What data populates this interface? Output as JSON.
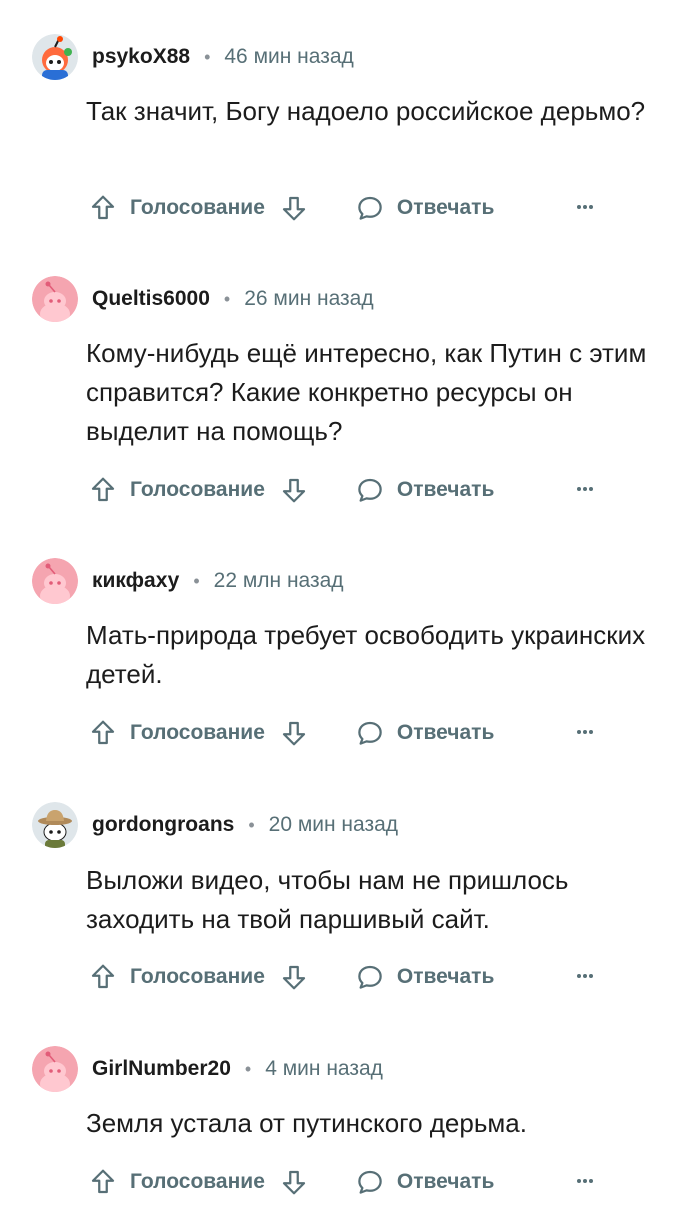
{
  "comments": [
    {
      "username": "psykoX88",
      "time": "46 мин назад",
      "text": "Так значит, Богу надоело российское дерьмо?",
      "vote_label": "Голосование",
      "reply_label": "Отвечать",
      "more": "···",
      "avatar": "snoo-redhead-avatar"
    },
    {
      "username": "Queltis6000",
      "time": "26 мин назад",
      "text": "Кому-нибудь ещё интересно, как Путин с этим справится? Какие конкретно ресурсы он выделит на помощь?",
      "vote_label": "Голосование",
      "reply_label": "Отвечать",
      "more": "···",
      "avatar": "default-pink-snoo-avatar"
    },
    {
      "username": "кикфаху",
      "time": "22 млн назад",
      "text": "Мать-природа требует освободить украинских детей.",
      "vote_label": "Голосование",
      "reply_label": "Отвечать",
      "more": "···",
      "avatar": "default-pink-snoo-avatar"
    },
    {
      "username": "gordongroans",
      "time": "20 мин назад",
      "text": "Выложи видео, чтобы нам не пришлось заходить на твой паршивый сайт.",
      "vote_label": "Голосование",
      "reply_label": "Отвечать",
      "more": "···",
      "avatar": "snoo-cowboy-hat-avatar"
    },
    {
      "username": "GirlNumber20",
      "time": "4 мин назад",
      "text": "Земля устала от путинского дерьма.",
      "vote_label": "Голосование",
      "reply_label": "Отвечать",
      "more": "···",
      "avatar": "default-pink-snoo-avatar"
    }
  ],
  "colors": {
    "text": "#1c1c1c",
    "muted": "#576f76",
    "pink_avatar_bg": "#f5a5b0"
  }
}
